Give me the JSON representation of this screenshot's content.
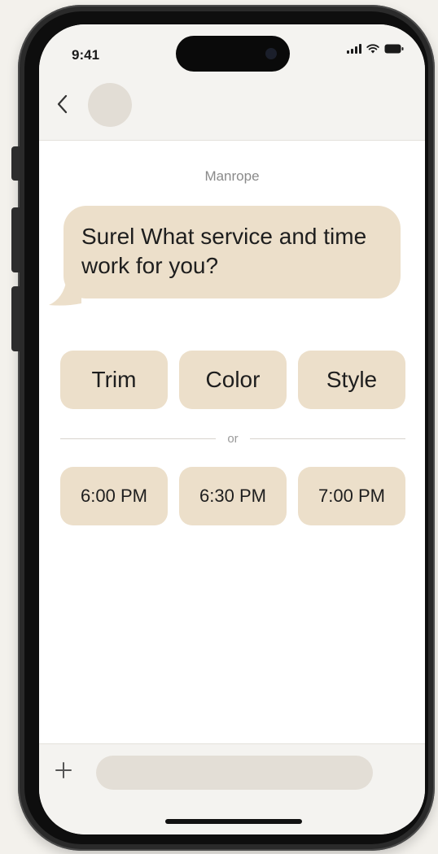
{
  "status_bar": {
    "time": "9:41"
  },
  "nav": {
    "back_icon": "chevron-left-icon",
    "avatar": "avatar"
  },
  "chat": {
    "contact_name": "Manrope",
    "message": "Surel What service and time work for you?"
  },
  "service_options": [
    {
      "label": "Trim"
    },
    {
      "label": "Color"
    },
    {
      "label": "Style"
    }
  ],
  "divider": {
    "label": "or"
  },
  "time_options": [
    {
      "label": "6:00 PM"
    },
    {
      "label": "6:30 PM"
    },
    {
      "label": "7:00 PM"
    }
  ],
  "composer": {
    "add_icon": "plus-icon",
    "input_value": "",
    "input_placeholder": ""
  },
  "colors": {
    "bubble": "#ecdfca",
    "chip": "#ecdfca",
    "screen_bg": "#ffffff",
    "bar_bg": "#f4f3f0",
    "input_bg": "#e3ded6"
  }
}
